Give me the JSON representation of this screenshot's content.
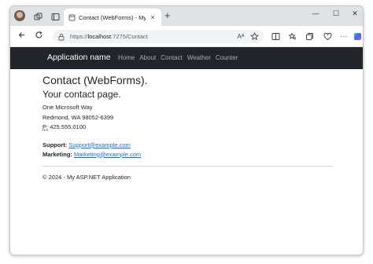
{
  "browser": {
    "tab_title": "Contact (WebForms) - My ASP.NE",
    "tab_close": "×",
    "new_tab": "+",
    "url_prefix": "https://",
    "url_host": "localhost",
    "url_rest": ":7275/Contact",
    "read_aloud": "Aᴬ",
    "win_minimize": "—",
    "win_maximize": "☐",
    "win_close": "✕",
    "more": "···"
  },
  "navbar": {
    "brand": "Application name",
    "links": [
      "Home",
      "About",
      "Contact",
      "Weather",
      "Counter"
    ]
  },
  "page": {
    "heading": "Contact (WebForms).",
    "subheading": "Your contact page.",
    "address_line1": "One Microsoft Way",
    "address_line2": "Redmond, WA 98052-6399",
    "phone_abbr": "P:",
    "phone": "425.555.0100",
    "support_label": "Support:",
    "support_email": "Support@example.com",
    "marketing_label": "Marketing:",
    "marketing_email": "Marketing@example.com",
    "footer": "© 2024 - My ASP.NET Application"
  },
  "colors": {
    "navbar_bg": "#212529",
    "link": "#0d6efd",
    "tabstrip_bg": "#dfe1e5"
  }
}
